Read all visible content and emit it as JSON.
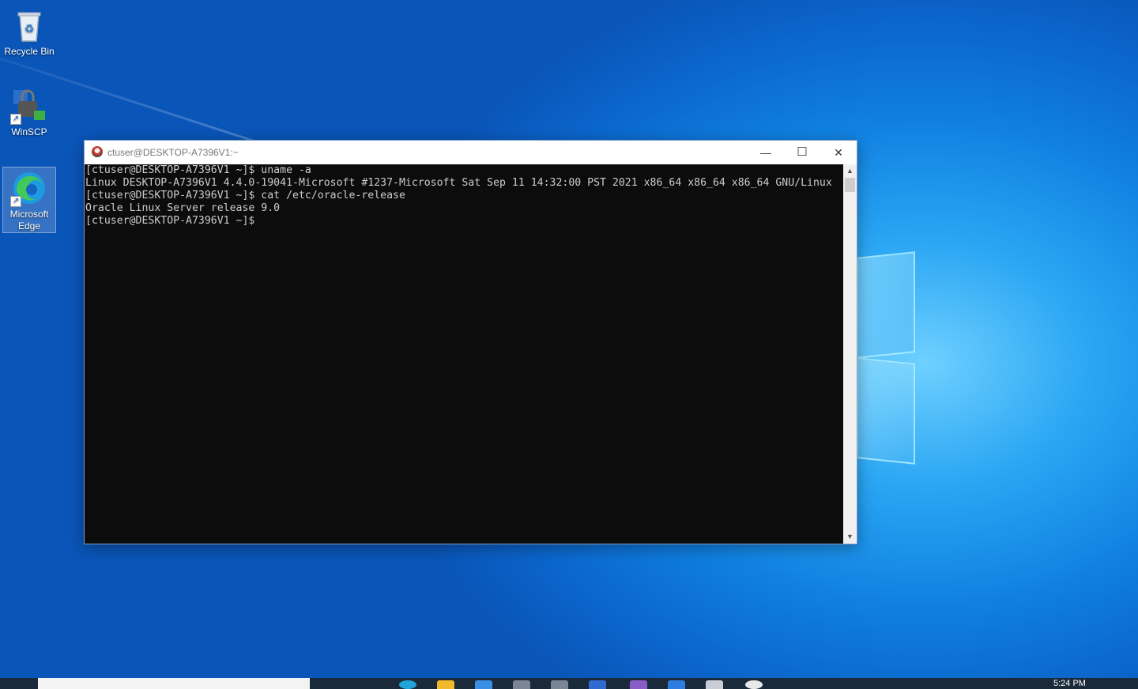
{
  "desktop": {
    "icons": [
      {
        "label": "Recycle Bin",
        "icon": "recycle-bin-icon"
      },
      {
        "label": "WinSCP",
        "icon": "winscp-icon"
      },
      {
        "label": "Microsoft Edge",
        "icon": "edge-icon"
      }
    ]
  },
  "window": {
    "title": "ctuser@DESKTOP-A7396V1:~",
    "minimize": "—",
    "maximize": "☐",
    "close": "✕"
  },
  "terminal": {
    "lines": [
      "[ctuser@DESKTOP-A7396V1 ~]$ uname -a",
      "Linux DESKTOP-A7396V1 4.4.0-19041-Microsoft #1237-Microsoft Sat Sep 11 14:32:00 PST 2021 x86_64 x86_64 x86_64 GNU/Linux",
      "[ctuser@DESKTOP-A7396V1 ~]$ cat /etc/oracle-release",
      "Oracle Linux Server release 9.0",
      "[ctuser@DESKTOP-A7396V1 ~]$"
    ]
  },
  "taskbar": {
    "clock": "5:24 PM"
  },
  "colors": {
    "terminal_bg": "#0c0c0c",
    "terminal_fg": "#cccccc",
    "desktop_accent": "#0f7fe0"
  }
}
